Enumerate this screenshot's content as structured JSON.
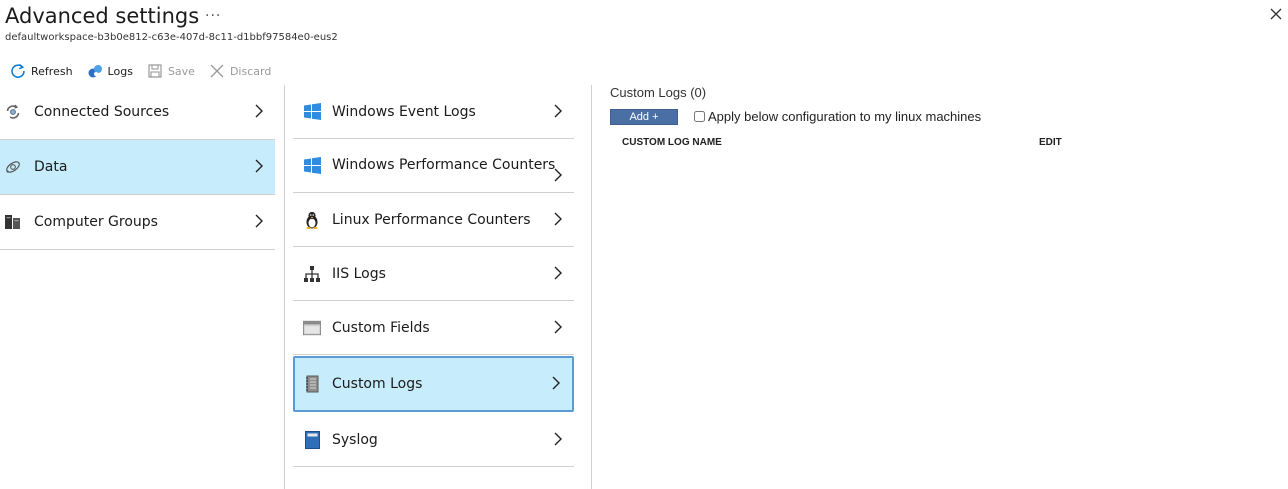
{
  "header": {
    "title": "Advanced settings",
    "more": "···",
    "subtitle": "defaultworkspace-b3b0e812-c63e-407d-8c11-d1bbf97584e0-eus2"
  },
  "toolbar": {
    "refresh": "Refresh",
    "logs": "Logs",
    "save": "Save",
    "discard": "Discard"
  },
  "nav1": {
    "items": [
      {
        "label": "Connected Sources",
        "icon": "connected-sources-icon",
        "selected": false
      },
      {
        "label": "Data",
        "icon": "data-icon",
        "selected": true
      },
      {
        "label": "Computer Groups",
        "icon": "computer-groups-icon",
        "selected": false
      }
    ]
  },
  "nav2": {
    "items": [
      {
        "label": "Windows Event Logs",
        "icon": "windows-icon",
        "selected": false
      },
      {
        "label": "Windows Performance Counters",
        "icon": "windows-icon",
        "selected": false
      },
      {
        "label": "Linux Performance Counters",
        "icon": "linux-icon",
        "selected": false
      },
      {
        "label": "IIS Logs",
        "icon": "network-icon",
        "selected": false
      },
      {
        "label": "Custom Fields",
        "icon": "window-icon",
        "selected": false
      },
      {
        "label": "Custom Logs",
        "icon": "notebook-icon",
        "selected": true
      },
      {
        "label": "Syslog",
        "icon": "book-icon",
        "selected": false
      }
    ]
  },
  "panel": {
    "title": "Custom Logs (0)",
    "add_label": "Add +",
    "apply_label": "Apply below configuration to my linux machines",
    "apply_checked": false,
    "columns": [
      "CUSTOM LOG NAME",
      "EDIT"
    ]
  },
  "colors": {
    "selected_bg": "#c7ecfb",
    "selected_border": "#5b9bd5",
    "add_button": "#4a6fa5",
    "accent": "#0078d4"
  }
}
